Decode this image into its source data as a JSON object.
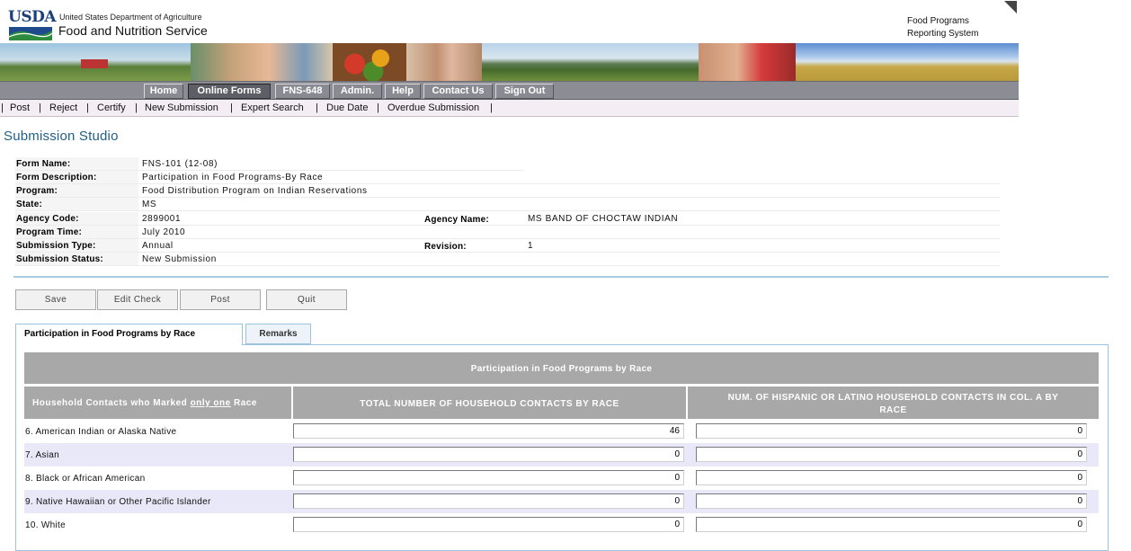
{
  "header": {
    "logo_text": "USDA",
    "department": "United States Department of Agriculture",
    "agency": "Food and Nutrition Service",
    "system_line1": "Food Programs",
    "system_line2": "Reporting System"
  },
  "nav": {
    "items": [
      {
        "label": "Home",
        "active": false
      },
      {
        "label": "Online Forms",
        "active": true
      },
      {
        "label": "FNS-648",
        "active": false
      },
      {
        "label": "Admin.",
        "active": false
      },
      {
        "label": "Help",
        "active": false
      },
      {
        "label": "Contact Us",
        "active": false
      },
      {
        "label": "Sign Out",
        "active": false
      }
    ]
  },
  "subnav": {
    "items": [
      "Post",
      "Reject",
      "Certify",
      "New Submission",
      "Expert Search",
      "Due Date",
      "Overdue Submission"
    ]
  },
  "page": {
    "title": "Submission Studio"
  },
  "info": {
    "form_name_label": "Form Name:",
    "form_name": "FNS-101 (12-08)",
    "form_description_label": "Form Description:",
    "form_description": "Participation in Food Programs-By Race",
    "program_label": "Program:",
    "program": "Food Distribution Program on Indian Reservations",
    "state_label": "State:",
    "state": "MS",
    "agency_code_label": "Agency Code:",
    "agency_code": "2899001",
    "agency_name_label": "Agency Name:",
    "agency_name": "MS BAND OF CHOCTAW INDIAN",
    "program_time_label": "Program Time:",
    "program_time": "July 2010",
    "submission_type_label": "Submission Type:",
    "submission_type": "Annual",
    "revision_label": "Revision:",
    "revision": "1",
    "submission_status_label": "Submission Status:",
    "submission_status": "New Submission"
  },
  "actions": {
    "save": "Save",
    "edit_check": "Edit Check",
    "post": "Post",
    "quit": "Quit"
  },
  "tabs": {
    "participation": "Participation in Food Programs by Race",
    "remarks": "Remarks"
  },
  "grid": {
    "title": "Participation in Food Programs by Race",
    "col0_prefix": "Household Contacts who Marked ",
    "col0_emph": "only one",
    "col0_suffix": " Race",
    "col1": "TOTAL NUMBER OF HOUSEHOLD CONTACTS BY RACE",
    "col2": "NUM. OF HISPANIC OR LATINO HOUSEHOLD CONTACTS IN COL. A BY RACE",
    "rows": [
      {
        "label": "6. American Indian or Alaska Native",
        "total": "46",
        "hispanic": "0"
      },
      {
        "label": "7. Asian",
        "total": "0",
        "hispanic": "0"
      },
      {
        "label": "8. Black or African American",
        "total": "0",
        "hispanic": "0"
      },
      {
        "label": "9. Native Hawaiian or Other Pacific Islander",
        "total": "0",
        "hispanic": "0"
      },
      {
        "label": "10. White",
        "total": "0",
        "hispanic": "0"
      }
    ]
  },
  "colors": {
    "title_blue": "#1f5e86",
    "nav_gray": "#8c8c94",
    "grid_header_gray": "#a8a8a8",
    "row_alt": "#e8e8f8",
    "tab_border": "#9cc3dd"
  }
}
